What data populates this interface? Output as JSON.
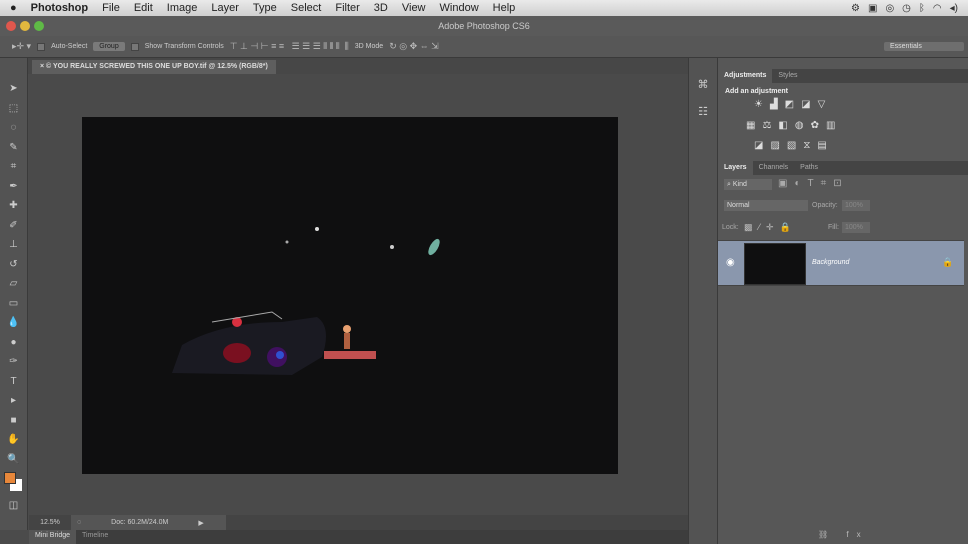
{
  "menubar": {
    "apple": "",
    "app": "Photoshop",
    "items": [
      "File",
      "Edit",
      "Image",
      "Layer",
      "Type",
      "Select",
      "Filter",
      "3D",
      "View",
      "Window",
      "Help"
    ]
  },
  "window": {
    "title": "Adobe Photoshop CS6"
  },
  "options": {
    "auto_select": "Auto-Select",
    "group": "Group",
    "show_transform": "Show Transform Controls",
    "mode": "3D Mode",
    "workspace": "Essentials"
  },
  "document": {
    "tab": "× © YOU REALLY SCREWED THIS ONE UP BOY.tif @ 12.5% (RGB/8*)"
  },
  "status": {
    "zoom": "12.5%",
    "doc": "Doc: 60.2M/24.0M"
  },
  "bottom_tabs": [
    "Mini Bridge",
    "Timeline"
  ],
  "adjustments": {
    "tabs": [
      "Adjustments",
      "Styles"
    ],
    "heading": "Add an adjustment"
  },
  "layers": {
    "tabs": [
      "Layers",
      "Channels",
      "Paths"
    ],
    "filter": "Kind",
    "blend": "Normal",
    "opacity_label": "Opacity:",
    "opacity": "100%",
    "lock_label": "Lock:",
    "fill_label": "Fill:",
    "fill": "100%",
    "items": [
      {
        "name": "Background",
        "visible": true,
        "locked": true
      }
    ]
  },
  "colors": {
    "foreground": "#e8873a",
    "background": "#ffffff",
    "layer_selected": "#8a97ad"
  }
}
